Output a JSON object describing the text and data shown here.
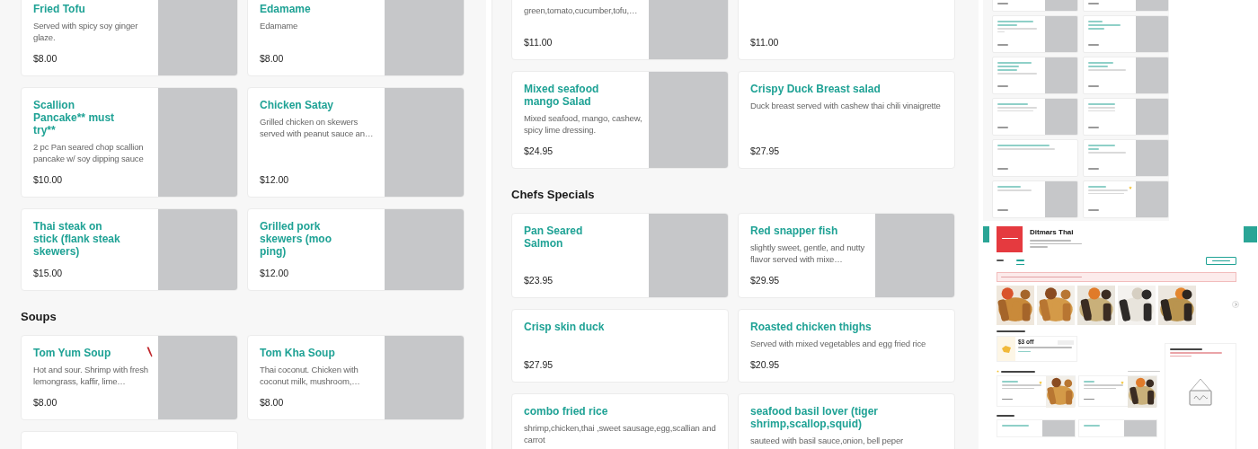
{
  "panels": [
    {
      "kind": "menu",
      "sections": [
        {
          "items": [
            {
              "name": "Fried Tofu",
              "description": "Served with spicy soy ginger glaze.",
              "price": "$8.00",
              "image": true,
              "spicy": false
            },
            {
              "name": "Edamame",
              "description": "Edamame",
              "price": "$8.00",
              "image": true,
              "spicy": false
            },
            {
              "name": "Scallion\nPancake** must\ntry**",
              "description": "2 pc Pan seared chop scallion pancake w/ soy dipping sauce",
              "price": "$10.00",
              "image": true,
              "spicy": false
            },
            {
              "name": "Chicken Satay",
              "description": "Grilled chicken on skewers served with peanut sauce an…",
              "price": "$12.00",
              "image": true,
              "spicy": false
            },
            {
              "name": "Thai steak on\nstick (flank steak\nskewers)",
              "price": "$15.00",
              "image": true,
              "spicy": false
            },
            {
              "name": "Grilled pork\nskewers (moo\nping)",
              "price": "$12.00",
              "image": true,
              "spicy": false
            }
          ]
        },
        {
          "heading": "Soups",
          "items": [
            {
              "name": "Tom Yum Soup",
              "description": "Hot and sour. Shrimp with fresh lemongrass, kaffir, lime…",
              "price": "$8.00",
              "image": true,
              "spicy": true
            },
            {
              "name": "Tom Kha Soup",
              "description": "Thai coconut. Chicken with coconut milk, mushroom,…",
              "price": "$8.00",
              "image": true,
              "spicy": false
            },
            {
              "image": false,
              "spicy": false
            }
          ]
        }
      ]
    },
    {
      "kind": "menu",
      "sections": [
        {
          "items": [
            {
              "description": "green,tomato,cucumber,tofu,…",
              "price": "$11.00",
              "image": true,
              "spicy": false
            },
            {
              "price": "$11.00",
              "image": false,
              "spicy": false
            },
            {
              "name": "Mixed seafood\nmango Salad",
              "description": "Mixed seafood, mango, cashew, spicy lime dressing.",
              "price": "$24.95",
              "image": true,
              "spicy": false
            },
            {
              "name": "Crispy Duck Breast salad",
              "description": "Duck breast served with cashew thai chili vinaigrette",
              "price": "$27.95",
              "image": false,
              "spicy": false
            }
          ]
        },
        {
          "heading": "Chefs Specials",
          "items": [
            {
              "name": "Pan Seared\nSalmon",
              "price": "$23.95",
              "image": true,
              "spicy": false
            },
            {
              "name": "Red snapper fish",
              "description": "slightly sweet, gentle, and nutty flavor served with mixe…",
              "price": "$29.95",
              "image": true,
              "spicy": false
            },
            {
              "name": "Crisp skin duck",
              "price": "$27.95",
              "image": false,
              "spicy": false
            },
            {
              "name": "Roasted chicken thighs",
              "description": "Served with mixed vegetables and egg fried rice",
              "price": "$20.95",
              "image": false,
              "spicy": false
            },
            {
              "name": "combo fried rice",
              "description": "shrimp,chicken,thai ,sweet sausage,egg,scallian and carrot",
              "image": false,
              "spicy": false
            },
            {
              "name": "seafood basil lover (tiger\nshrimp,scallop,squid)",
              "description": "sauteed with basil sauce,onion, bell peper",
              "image": false,
              "spicy": false
            }
          ]
        }
      ]
    },
    {
      "kind": "preview",
      "mini_menu": {
        "items": [
          {
            "image": true,
            "popular": false
          },
          {
            "image": true,
            "popular": false
          },
          {
            "image": true,
            "popular": false
          },
          {
            "image": true,
            "popular": false
          },
          {
            "image": true,
            "popular": false
          },
          {
            "image": true,
            "popular": false
          },
          {
            "image": true,
            "popular": false
          },
          {
            "image": true,
            "popular": false
          },
          {
            "image": false,
            "popular": false
          },
          {
            "image": true,
            "popular": false
          },
          {
            "image": true,
            "popular": false
          },
          {
            "image": true,
            "popular": true
          }
        ]
      },
      "restaurant": {
        "name": "Ditmars Thai",
        "tabs": [
          {
            "selected": false
          },
          {
            "selected": true
          }
        ],
        "deal": {
          "title": "$3 off"
        },
        "popular": [
          {
            "popular": true
          },
          {
            "popular": true
          }
        ]
      }
    }
  ]
}
